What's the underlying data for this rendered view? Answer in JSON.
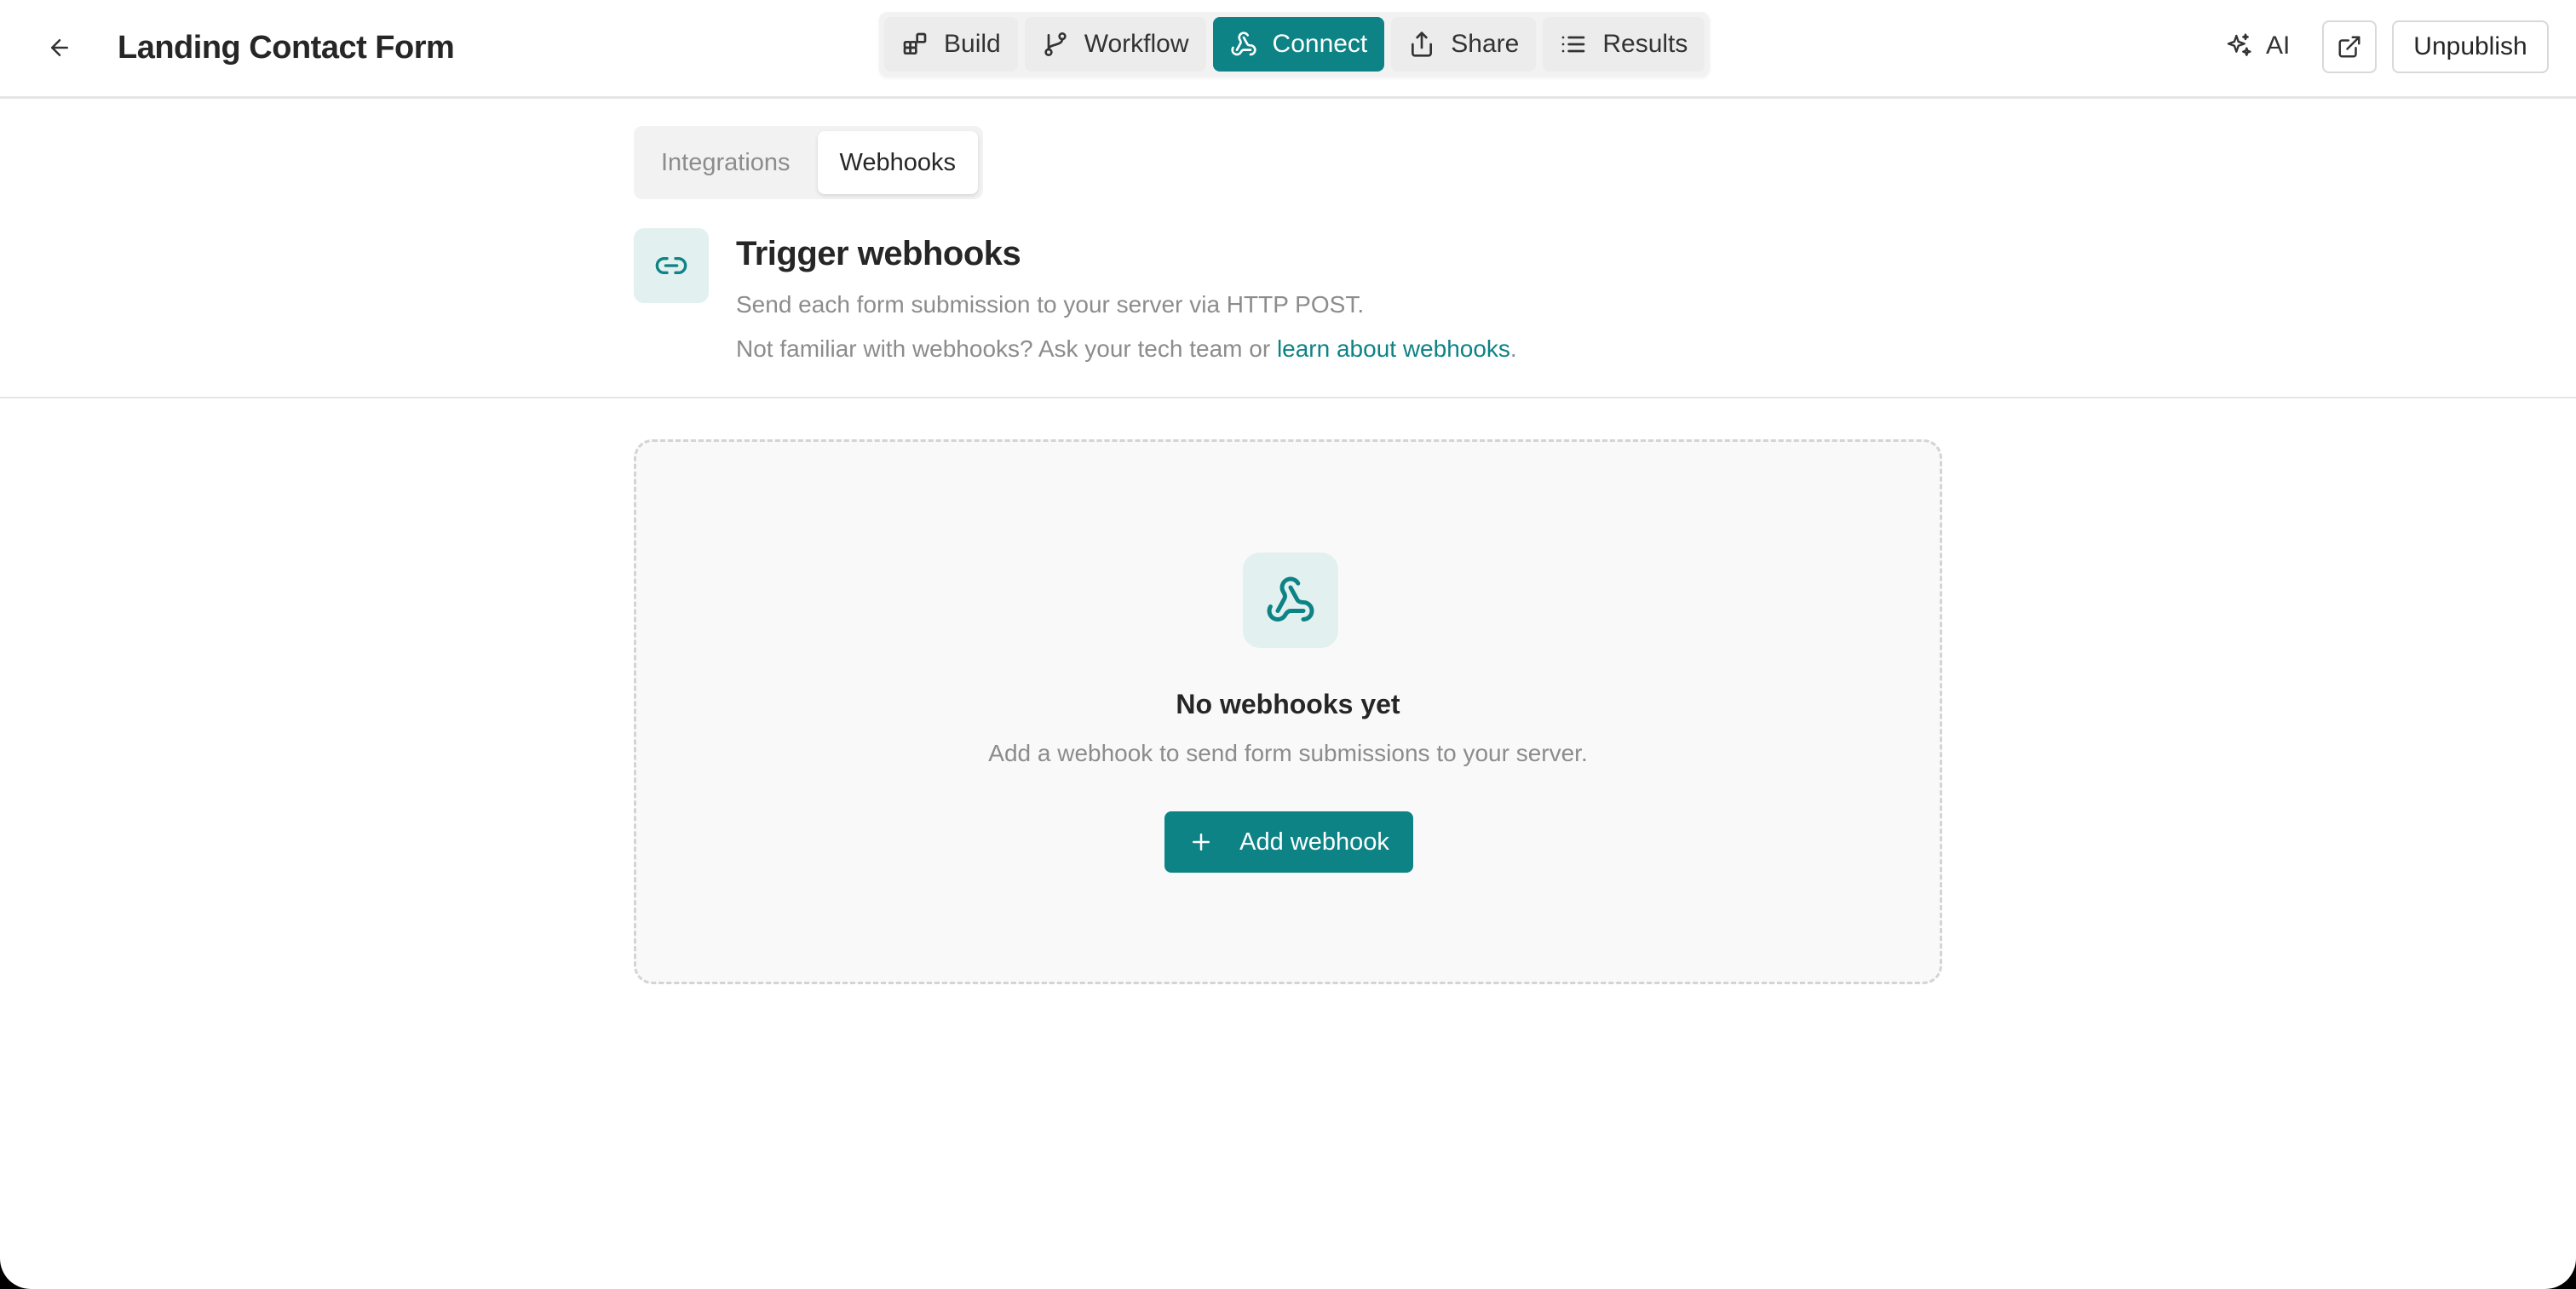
{
  "header": {
    "title": "Landing Contact Form",
    "nav": [
      {
        "label": "Build",
        "icon": "blocks-icon"
      },
      {
        "label": "Workflow",
        "icon": "git-branch-icon"
      },
      {
        "label": "Connect",
        "icon": "webhook-icon",
        "active": true
      },
      {
        "label": "Share",
        "icon": "share-icon"
      },
      {
        "label": "Results",
        "icon": "list-icon"
      }
    ],
    "ai_label": "AI",
    "unpublish_label": "Unpublish"
  },
  "subtabs": [
    {
      "label": "Integrations",
      "active": false
    },
    {
      "label": "Webhooks",
      "active": true
    }
  ],
  "section": {
    "title": "Trigger webhooks",
    "description": "Send each form submission to your server via HTTP POST.",
    "note_prefix": "Not familiar with webhooks? Ask your tech team or ",
    "note_link": "learn about webhooks",
    "note_suffix": "."
  },
  "empty_state": {
    "title": "No webhooks yet",
    "description": "Add a webhook to send form submissions to your server.",
    "button_label": "Add webhook"
  },
  "colors": {
    "accent": "#0d8385",
    "accent_soft": "#e3f0f0"
  }
}
